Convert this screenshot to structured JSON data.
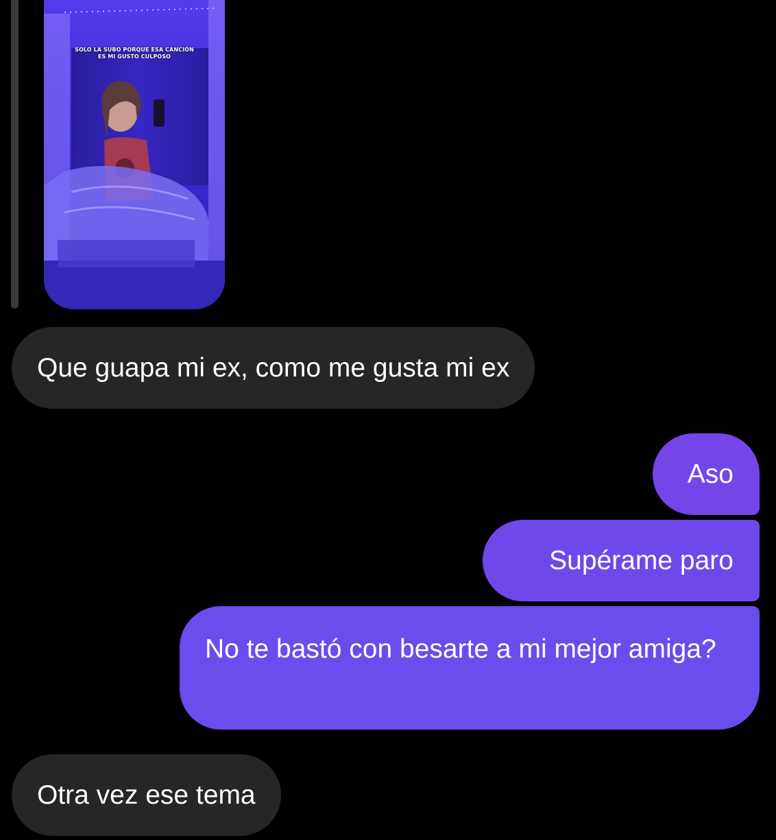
{
  "story": {
    "caption_line1": "SOLO LA SUBO PORQUE ESA CANCIÓN",
    "caption_line2": "ES MI GUSTO CULPOSO"
  },
  "messages": [
    {
      "side": "incoming",
      "text": "Que guapa mi ex, como me gusta mi ex"
    },
    {
      "side": "outgoing",
      "text": "Aso"
    },
    {
      "side": "outgoing",
      "text": "Supérame paro"
    },
    {
      "side": "outgoing",
      "text": "No te bastó con besarte a mi mejor amiga?"
    },
    {
      "side": "incoming",
      "text": "Otra vez ese tema"
    }
  ],
  "colors": {
    "background": "#000000",
    "incoming_bubble": "#262626",
    "outgoing_bubble": "#7046eb",
    "story_tint": "#3b2ad6"
  }
}
